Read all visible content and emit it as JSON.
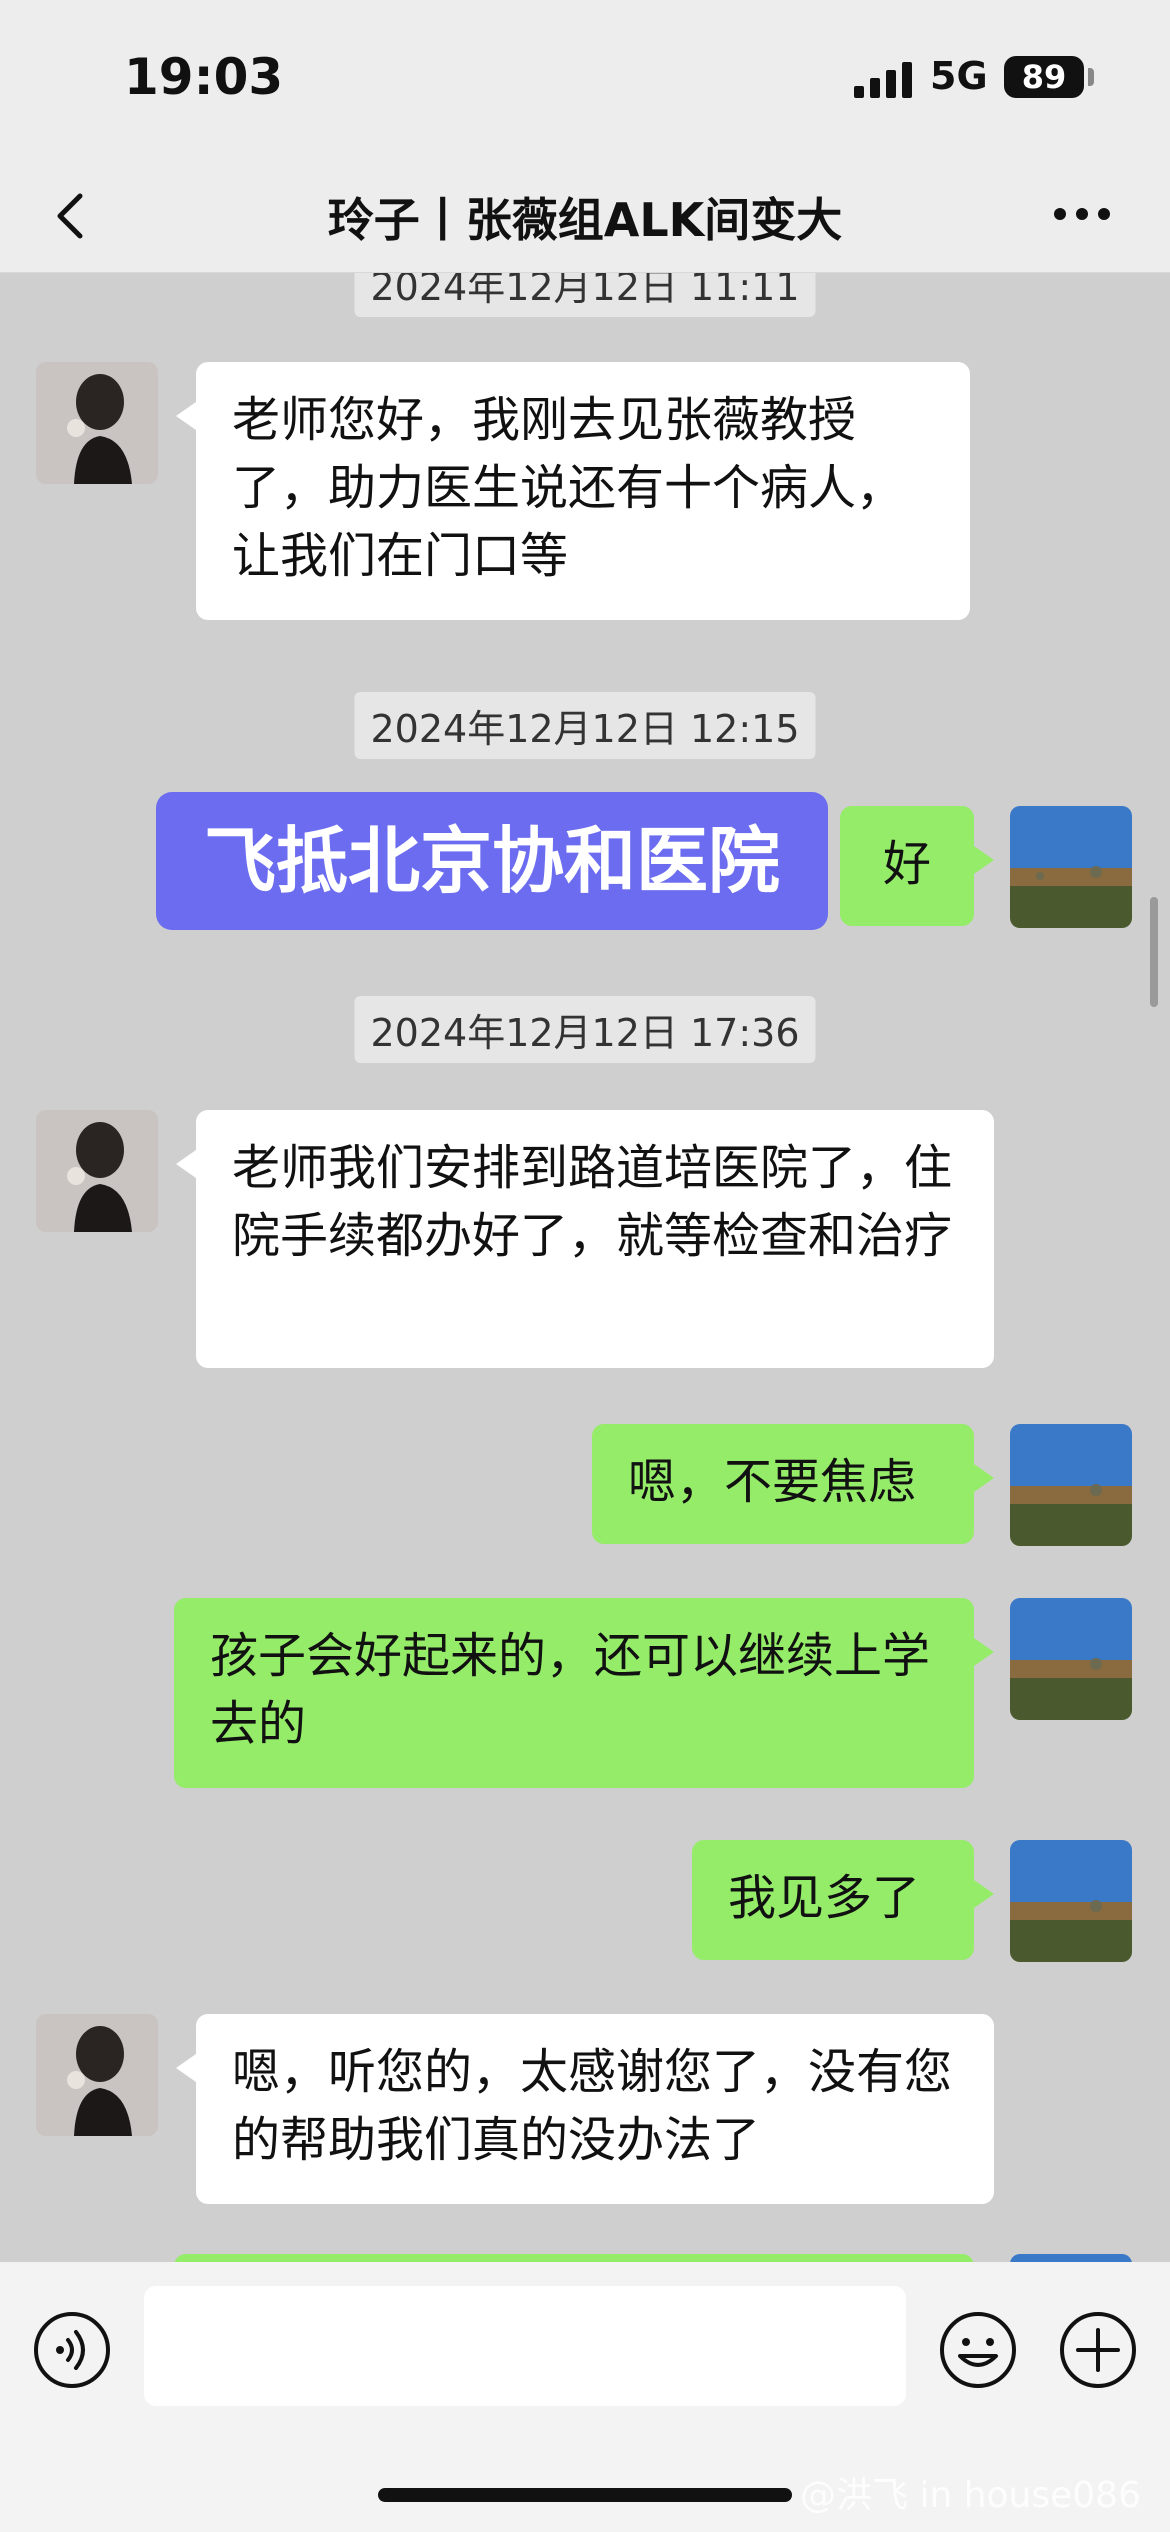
{
  "status": {
    "time": "19:03",
    "network": "5G",
    "battery": "89"
  },
  "header": {
    "title": "玲子丨张薇组ALK间变大"
  },
  "timestamps": {
    "t0": "2024年12月12日 11:11",
    "t1": "2024年12月12日 12:15",
    "t2": "2024年12月12日 17:36"
  },
  "messages": {
    "m1": "老师您好，我刚去见张薇教授了，助力医生说还有十个病人，让我们在门口等",
    "m2": "好",
    "m3": "老师我们安排到路道培医院了，住院手续都办好了，就等检查和治疗",
    "m4": "嗯，不要焦虑",
    "m5": "孩子会好起来的，还可以继续上学去的",
    "m6": "我见多了",
    "m7": "嗯，听您的，太感谢您了，没有您的帮助我们真的没办法了"
  },
  "overlay": {
    "caption": "飞抵北京协和医院"
  },
  "watermark": "@洪飞 in house086",
  "icons": [
    "back-arrow-icon",
    "more-dots-icon",
    "voice-icon",
    "emoji-icon",
    "plus-icon"
  ]
}
